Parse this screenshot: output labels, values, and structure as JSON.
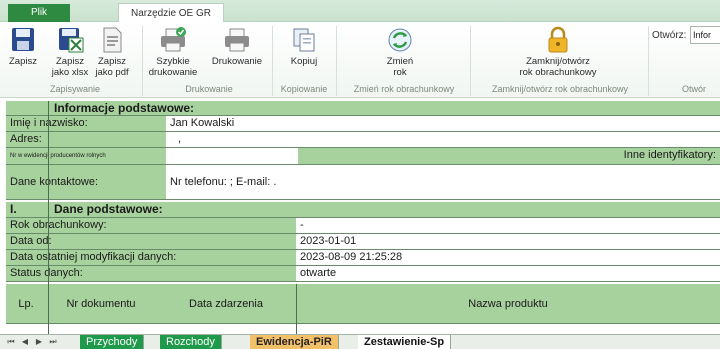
{
  "ribbon_tabs": {
    "file": "Plik",
    "tool": "Narzędzie OE GR"
  },
  "ribbon": {
    "zapisz": "Zapisz",
    "zapisz_xlsx_1": "Zapisz",
    "zapisz_xlsx_2": "jako xlsx",
    "zapisz_pdf_1": "Zapisz",
    "zapisz_pdf_2": "jako pdf",
    "group_zapisywanie": "Zapisywanie",
    "szybkie_1": "Szybkie",
    "szybkie_2": "drukowanie",
    "drukowanie": "Drukowanie",
    "group_drukowanie": "Drukowanie",
    "kopiuj": "Kopiuj",
    "group_kopiowanie": "Kopiowanie",
    "zmien_1": "Zmień",
    "zmien_2": "rok",
    "group_zmien": "Zmień rok obrachunkowy",
    "zamknij_1": "Zamknij/otwórz",
    "zamknij_2": "rok obrachunkowy",
    "group_zamknij": "Zamknij/otwórz rok obrachunkowy",
    "otworz_label": "Otwórz:",
    "otworz_value": "Infor",
    "group_otworz": "Otwór"
  },
  "form": {
    "section1_title": "Informacje podstawowe:",
    "name_label": "Imię i nazwisko:",
    "name_value": "Jan Kowalski",
    "address_label": "Adres:",
    "address_value": ",",
    "prodnr_label": "Nr w ewidencji producentów rolnych",
    "inne_label": "Inne identyfikatory:",
    "contact_label": "Dane kontaktowe:",
    "contact_value": "Nr telefonu: ; E-mail: .",
    "section2_num": "I.",
    "section2_title": "Dane podstawowe:",
    "rok_label": "Rok obrachunkowy:",
    "rok_value": "-",
    "data_od_label": "Data od:",
    "data_od_value": "2023-01-01",
    "mod_label": "Data ostatniej modyfikacji danych:",
    "mod_value": "2023-08-09 21:25:28",
    "status_label": "Status danych:",
    "status_value": "otwarte",
    "col_lp": "Lp.",
    "col_nr": "Nr dokumentu",
    "col_data": "Data zdarzenia",
    "col_nazwa": "Nazwa produktu"
  },
  "sheet_tabs": [
    "Przychody",
    "Rozchody",
    "Ewidencja-PiR",
    "Zestawienie-Sp"
  ],
  "colors": {
    "green_cell": "#a7d29d",
    "ribbon_file_tab": "#2f8a41",
    "tab_przychody": "#1f9a4a",
    "tab_ewidencja": "#f3c06a"
  }
}
